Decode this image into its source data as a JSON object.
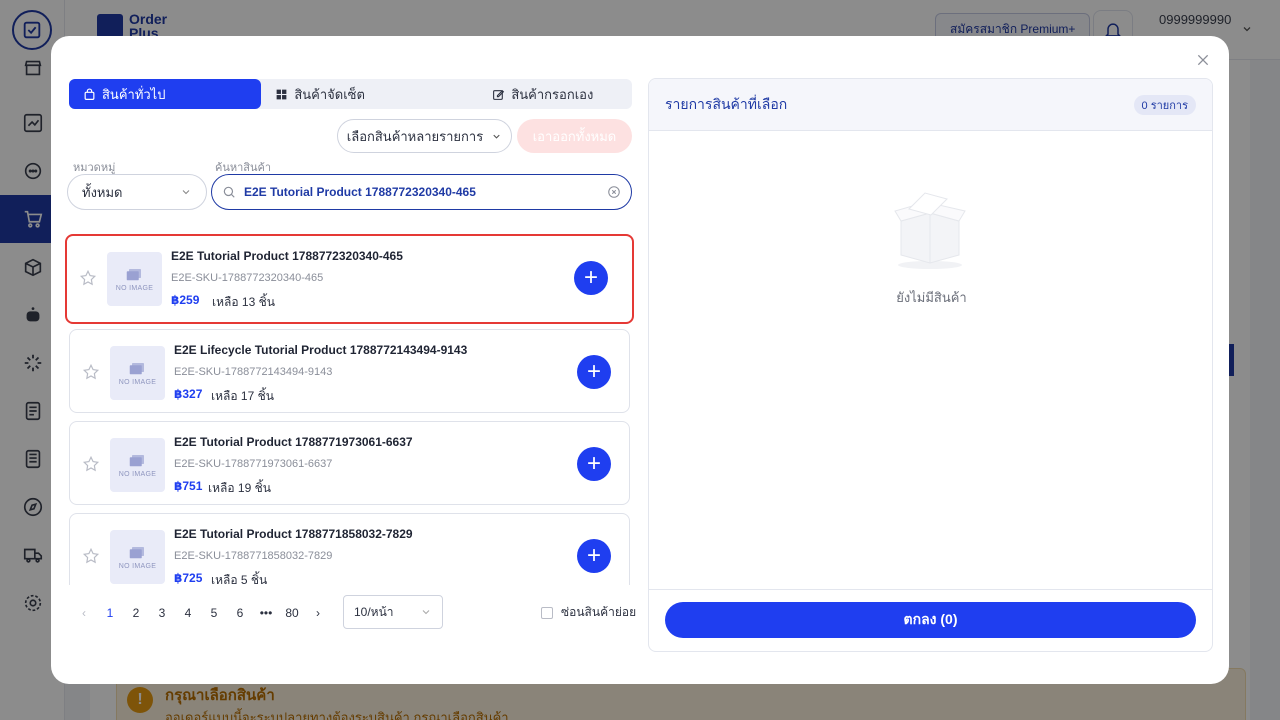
{
  "app": {
    "brand": "Order Plus",
    "premium_label": "สมัครสมาชิก Premium+",
    "phone": "0999999990",
    "warning_title": "กรุณาเลือกสินค้า",
    "warning_text": "ออเดอร์แบบนี้จะระบุปลายทางต้องระบุสินค้า กรุณาเลือกสินค้า"
  },
  "modal": {
    "tabs": [
      {
        "label": "สินค้าทั่วไป",
        "icon": "shopping-bag-icon"
      },
      {
        "label": "สินค้าจัดเซ็ต",
        "icon": "grid-icon"
      },
      {
        "label": "สินค้ากรอกเอง",
        "icon": "edit-icon"
      }
    ],
    "multi_select_label": "เลือกสินค้าหลายรายการ",
    "remove_all_label": "เอาออกทั้งหมด",
    "category_label": "หมวดหมู่",
    "category_value": "ทั้งหมด",
    "search_label": "ค้นหาสินค้า",
    "search_value": "E2E Tutorial Product 1788772320340-465",
    "products": [
      {
        "name": "E2E Tutorial Product 1788772320340-465",
        "sku": "E2E-SKU-1788772320340-465",
        "price": "฿259",
        "stock": "เหลือ 13 ชิ้น",
        "image": "NO IMAGE"
      },
      {
        "name": "E2E Lifecycle Tutorial Product 1788772143494-9143",
        "sku": "E2E-SKU-1788772143494-9143",
        "price": "฿327",
        "stock": "เหลือ 17 ชิ้น",
        "image": "NO IMAGE"
      },
      {
        "name": "E2E Tutorial Product 1788771973061-6637",
        "sku": "E2E-SKU-1788771973061-6637",
        "price": "฿751",
        "stock": "เหลือ 19 ชิ้น",
        "image": "NO IMAGE"
      },
      {
        "name": "E2E Tutorial Product 1788771858032-7829",
        "sku": "E2E-SKU-1788771858032-7829",
        "price": "฿725",
        "stock": "เหลือ 5 ชิ้น",
        "image": "NO IMAGE"
      }
    ],
    "pagination": {
      "pages": [
        "1",
        "2",
        "3",
        "4",
        "5",
        "6",
        "•••",
        "80"
      ],
      "current": "1",
      "page_size": "10/หน้า"
    },
    "hide_sub_label": "ซ่อนสินค้าย่อย",
    "selected_title": "รายการสินค้าที่เลือก",
    "selected_count": "0 รายการ",
    "empty_text": "ยังไม่มีสินค้า",
    "confirm_label": "ตกลง (0)"
  },
  "colors": {
    "primary": "#1f3ef0",
    "brand": "#1f3aa5",
    "highlight": "#e53935"
  }
}
